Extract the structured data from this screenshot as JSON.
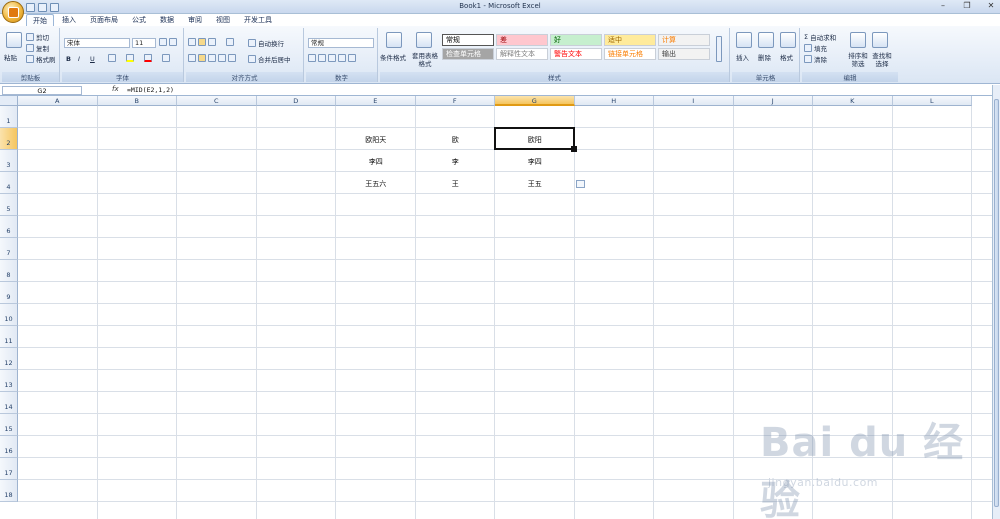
{
  "window": {
    "title": "Book1 - Microsoft Excel"
  },
  "tabs": [
    "开始",
    "插入",
    "页面布局",
    "公式",
    "数据",
    "审阅",
    "视图",
    "开发工具"
  ],
  "ribbon": {
    "clipboard": {
      "label": "剪贴板",
      "paste": "粘贴",
      "cut": "剪切",
      "copy": "复制",
      "format_painter": "格式刷"
    },
    "font": {
      "label": "字体",
      "name": "宋体",
      "size": "11",
      "bold": "B",
      "italic": "I",
      "underline": "U"
    },
    "alignment": {
      "label": "对齐方式",
      "wrap": "自动换行",
      "merge": "合并后居中"
    },
    "number": {
      "label": "数字",
      "format": "常规"
    },
    "styles": {
      "label": "样式",
      "conditional": "条件格式",
      "table_format": "套用表格格式",
      "items": [
        {
          "text": "常规",
          "bg": "#ffffff",
          "color": "#000000"
        },
        {
          "text": "差",
          "bg": "#ffc7ce",
          "color": "#9c0006"
        },
        {
          "text": "好",
          "bg": "#c6efce",
          "color": "#006100"
        },
        {
          "text": "适中",
          "bg": "#ffeb9c",
          "color": "#9c6500"
        },
        {
          "text": "计算",
          "bg": "#f2f2f2",
          "color": "#fa7d00"
        },
        {
          "text": "检查单元格",
          "bg": "#a5a5a5",
          "color": "#ffffff"
        },
        {
          "text": "解释性文本",
          "bg": "#ffffff",
          "color": "#7f7f7f"
        },
        {
          "text": "警告文本",
          "bg": "#ffffff",
          "color": "#ff0000"
        },
        {
          "text": "链接单元格",
          "bg": "#ffffff",
          "color": "#fa7d00"
        },
        {
          "text": "输出",
          "bg": "#f2f2f2",
          "color": "#3f3f3f"
        }
      ]
    },
    "cells": {
      "label": "单元格",
      "insert": "插入",
      "delete": "删除",
      "format": "格式"
    },
    "editing": {
      "label": "编辑",
      "autosum": "自动求和",
      "fill": "填充",
      "clear": "清除",
      "sort": "排序和筛选",
      "find": "查找和选择"
    }
  },
  "formula_bar": {
    "name_box": "G2",
    "fx": "fx",
    "formula": "=MID(E2,1,2)"
  },
  "columns": [
    "A",
    "B",
    "C",
    "D",
    "E",
    "F",
    "G",
    "H",
    "I",
    "J",
    "K",
    "L"
  ],
  "selected_column": "G",
  "rows": [
    "1",
    "2",
    "3",
    "4",
    "5",
    "6",
    "7",
    "8",
    "9",
    "10",
    "11",
    "12",
    "13",
    "14",
    "15",
    "16",
    "17",
    "18"
  ],
  "selected_row": "2",
  "cells": [
    {
      "ref": "E2",
      "value": "欧阳天"
    },
    {
      "ref": "F2",
      "value": "欧"
    },
    {
      "ref": "G2",
      "value": "欧阳"
    },
    {
      "ref": "E3",
      "value": "李四"
    },
    {
      "ref": "F3",
      "value": "李"
    },
    {
      "ref": "G3",
      "value": "李四"
    },
    {
      "ref": "E4",
      "value": "王五六"
    },
    {
      "ref": "F4",
      "value": "王"
    },
    {
      "ref": "G4",
      "value": "王五"
    }
  ],
  "active_cell": "G2",
  "watermark": {
    "big": "Bai du 经验",
    "small": "jingyan.baidu.com"
  }
}
